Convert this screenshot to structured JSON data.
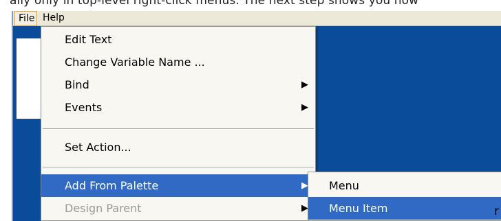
{
  "doc_text": "ally only in top-level right-click menus. The next step shows you how",
  "menubar": {
    "items": [
      "File",
      "Help"
    ]
  },
  "context_menu": {
    "items": [
      {
        "label": "Edit Text",
        "submenu": false,
        "state": "normal"
      },
      {
        "label": "Change Variable Name ...",
        "submenu": false,
        "state": "normal"
      },
      {
        "label": "Bind",
        "submenu": true,
        "state": "normal"
      },
      {
        "label": "Events",
        "submenu": true,
        "state": "normal"
      },
      {
        "label": "Set Action...",
        "submenu": false,
        "state": "normal"
      },
      {
        "label": "Add From Palette",
        "submenu": true,
        "state": "selected"
      },
      {
        "label": "Design Parent",
        "submenu": true,
        "state": "disabled"
      }
    ],
    "arrow_glyph": "▶"
  },
  "submenu": {
    "items": [
      {
        "label": "Menu",
        "state": "normal"
      },
      {
        "label": "Menu Item",
        "state": "selected"
      }
    ]
  },
  "edge_glyph": "r",
  "colors": {
    "menubar_bg": "#ece9d8",
    "design_area": "#0a4c9a",
    "selection": "#316ac5",
    "menu_bg": "#f8f7f2",
    "active_menu_border": "#f0a030"
  }
}
